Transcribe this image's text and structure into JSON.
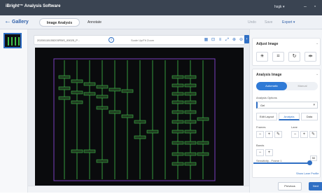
{
  "app": {
    "title": "iBright™ Analysis Software",
    "user": "hsgk ▾"
  },
  "nav": {
    "back_label": "Gallery",
    "tabs": [
      "Image Analysis",
      "Annotate"
    ],
    "actions": [
      "Undo",
      "Save"
    ],
    "export_label": "Export ▾"
  },
  "image_bar": {
    "name": "20200115155203FBIS_00025_P...",
    "zoom": "Scale Up/Fit Zoom"
  },
  "panel": {
    "adjust_title": "Adjust Image",
    "analysis_title": "Analysis Image",
    "mode_on": "Automatic",
    "mode_off": "Manual",
    "options_label": "Analysis Options",
    "options_value": "Gel",
    "tabs": [
      "Edit Layout",
      "Analysis",
      "Data"
    ],
    "frames_label": "Frames",
    "lane_label": "Lane",
    "bands_label": "Bands",
    "sensitivity_label": "Sensitivity - Frame 1",
    "sensitivity_value": "50",
    "show_lane_label": "Show Lane Profile",
    "prev_label": "Previous",
    "next_label": "Next"
  },
  "colors": {
    "accent": "#2f6fc4",
    "band": "#3fbf4a",
    "frame": "#7a3fc0"
  }
}
